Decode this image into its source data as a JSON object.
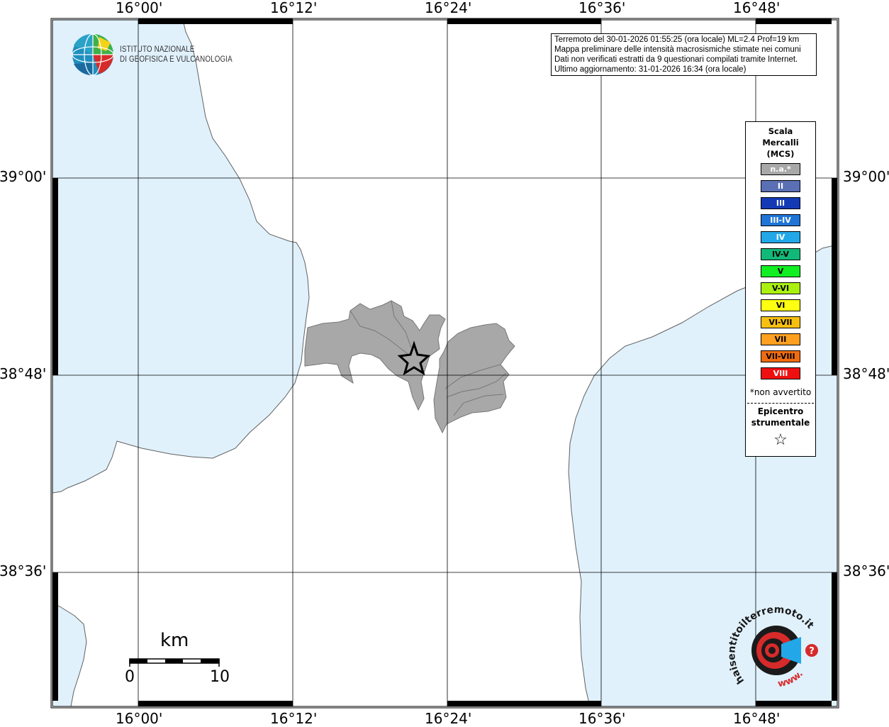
{
  "map": {
    "longitude_labels": [
      "16°00'",
      "16°12'",
      "16°24'",
      "16°36'",
      "16°48'"
    ],
    "latitude_labels": [
      "39°00'",
      "38°48'",
      "38°36'"
    ]
  },
  "info_box": {
    "lines": [
      "Terremoto del 30-01-2026 01:55:25 (ora locale) ML=2.4 Prof=19 km",
      "Mappa preliminare delle intensità macrosismiche stimate nei comuni",
      "Dati non verificati estratti da 9 questionari compilati tramite Internet.",
      "Ultimo aggiornamento: 31-01-2026 16:34 (ora locale)"
    ]
  },
  "logo": {
    "line1": "ISTITUTO NAZIONALE",
    "line2": "DI GEOFISICA E VULCANOLOGIA"
  },
  "legend": {
    "title_lines": [
      "Scala",
      "Mercalli",
      "(MCS)"
    ],
    "items": [
      {
        "label": "n.a.*",
        "color": "#a8a8a8"
      },
      {
        "label": "II",
        "color": "#5b6fb5"
      },
      {
        "label": "III",
        "color": "#1439b5"
      },
      {
        "label": "III-IV",
        "color": "#1f74d6"
      },
      {
        "label": "IV",
        "color": "#22a8e8"
      },
      {
        "label": "IV-V",
        "color": "#12b878"
      },
      {
        "label": "V",
        "color": "#11ee22"
      },
      {
        "label": "V-VI",
        "color": "#aaf011"
      },
      {
        "label": "VI",
        "color": "#ffff11"
      },
      {
        "label": "VI-VII",
        "color": "#f7c010"
      },
      {
        "label": "VII",
        "color": "#ffa020"
      },
      {
        "label": "VII-VIII",
        "color": "#f06c10"
      },
      {
        "label": "VIII",
        "color": "#ee1010"
      }
    ],
    "note": "*non avvertito",
    "epicenter_lines": [
      "Epicentro",
      "strumentale"
    ],
    "epicenter_symbol": "☆"
  },
  "scale_bar": {
    "unit": "km",
    "min": "0",
    "max": "10"
  },
  "badge": {
    "text_main": "haisentitoilterremoto",
    "text_suffix": ".it",
    "text_bottom": "www."
  },
  "colors": {
    "sea": "#e0f1fc",
    "land": "#ffffff",
    "affected_area": "#a8a8a8",
    "coast": "#606060"
  }
}
